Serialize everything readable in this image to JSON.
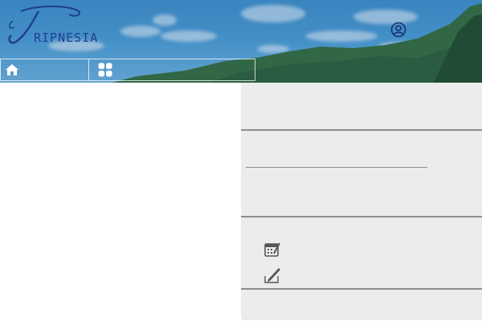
{
  "brand": {
    "logo_text": "Tripnesia"
  },
  "header": {
    "user_icon": "user-circle-icon"
  },
  "nav": {
    "items": [
      {
        "icon": "home-icon"
      },
      {
        "icon": "grid-icon"
      }
    ]
  },
  "side_panel": {
    "icons": [
      "calendar-edit-icon",
      "pencil-note-icon"
    ]
  },
  "colors": {
    "header_blue": "#4a9bd2",
    "panel_bg": "#ececec",
    "divider": "#8d8d8d",
    "logo_blue": "#1f3f8f"
  }
}
